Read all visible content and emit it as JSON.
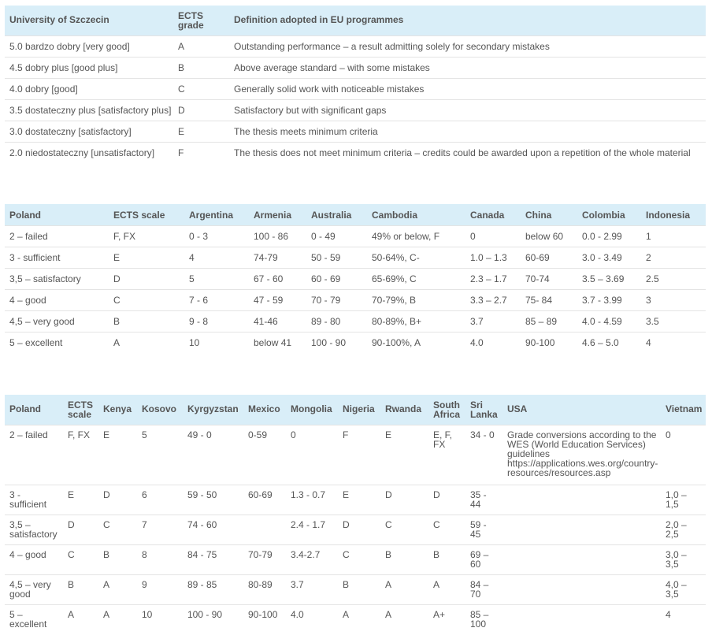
{
  "table1": {
    "headers": [
      "University of Szczecin",
      "ECTS\ngrade",
      "Definition adopted in EU programmes"
    ],
    "rows": [
      [
        "5.0 bardzo dobry [very good]",
        "A",
        "Outstanding performance – a result admitting solely for secondary mistakes"
      ],
      [
        "4.5 dobry plus [good plus]",
        "B",
        "Above average standard – with some mistakes"
      ],
      [
        "4.0 dobry [good]",
        "C",
        "Generally solid work with noticeable mistakes"
      ],
      [
        "3.5 dostateczny plus [satisfactory plus]",
        "D",
        "Satisfactory but with significant gaps"
      ],
      [
        "3.0 dostateczny [satisfactory]",
        "E",
        "The thesis meets minimum criteria"
      ],
      [
        "2.0 niedostateczny [unsatisfactory]",
        "F",
        "The thesis does not meet minimum criteria – credits could be awarded upon a repetition of the whole material"
      ]
    ]
  },
  "table2": {
    "headers": [
      "Poland",
      "ECTS scale",
      "Argentina",
      "Armenia",
      "Australia",
      "Cambodia",
      "Canada",
      "China",
      "Colombia",
      "Indonesia"
    ],
    "rows": [
      [
        "2 – failed",
        "F, FX",
        "0 - 3",
        "100 - 86",
        "0 - 49",
        "49% or below, F",
        "0",
        "below 60",
        "0.0 - 2.99",
        "1"
      ],
      [
        "3 - sufficient",
        "E",
        "4",
        "74-79",
        "50 - 59",
        "50-64%, C-",
        "1.0 – 1.3",
        "60-69",
        "3.0 - 3.49",
        "2"
      ],
      [
        "3,5 – satisfactory",
        "D",
        "5",
        "67 - 60",
        "60 - 69",
        "65-69%, C",
        "2.3 – 1.7",
        "70-74",
        "3.5 – 3.69",
        "2.5"
      ],
      [
        "4 – good",
        "C",
        "7 - 6",
        "47 - 59",
        "70 - 79",
        "70-79%, B",
        "3.3 – 2.7",
        "75- 84",
        "3.7 - 3.99",
        "3"
      ],
      [
        "4,5 – very good",
        "B",
        "9 - 8",
        "41-46",
        "89 - 80",
        "80-89%, B+",
        "3.7",
        "85 – 89",
        "4.0 - 4.59",
        "3.5"
      ],
      [
        "5 – excellent",
        "A",
        "10",
        "below 41",
        "100 - 90",
        "90-100%, A",
        "4.0",
        "90-100",
        "4.6 – 5.0",
        "4"
      ]
    ]
  },
  "table3": {
    "headers": [
      "Poland",
      "ECTS\nscale",
      "Kenya",
      "Kosovo",
      "Kyrgyzstan",
      "Mexico",
      "Mongolia",
      "Nigeria",
      "Rwanda",
      "South\nAfrica",
      "Sri\nLanka",
      "USA",
      "Vietnam"
    ],
    "rows": [
      [
        "2 – failed",
        "F, FX",
        "E",
        "5",
        "49 - 0",
        "0-59",
        "0",
        "F",
        "E",
        "E, F,\nFX",
        "34 - 0",
        "Grade conversions according to the\nWES (World Education Services)\nguidelines\nhttps://applications.wes.org/country-\nresources/resources.asp",
        "0"
      ],
      [
        "3 -\nsufficient",
        "E",
        "D",
        "6",
        "59 - 50",
        "60-69",
        "1.3 - 0.7",
        "E",
        "D",
        "D",
        "35 -\n44",
        "",
        "1,0 –\n1,5"
      ],
      [
        "3,5 –\nsatisfactory",
        "D",
        "C",
        "7",
        "74 - 60",
        "",
        "2.4 - 1.7",
        "D",
        "C",
        "C",
        "59 -\n45",
        "",
        "2,0 –\n2,5"
      ],
      [
        "4 – good",
        "C",
        "B",
        "8",
        "84 - 75",
        "70-79",
        "3.4-2.7",
        "C",
        "B",
        "B",
        "69 –\n60",
        "",
        "3,0 –\n3,5"
      ],
      [
        "4,5 – very\ngood",
        "B",
        "A",
        "9",
        "89 - 85",
        "80-89",
        "3.7",
        "B",
        "A",
        "A",
        "84 –\n70",
        "",
        "4,0 –\n3,5"
      ],
      [
        "5 –\nexcellent",
        "A",
        "A",
        "10",
        "100 - 90",
        "90-100",
        "4.0",
        "A",
        "A",
        "A+",
        "85 –\n100",
        "",
        "4"
      ]
    ]
  }
}
